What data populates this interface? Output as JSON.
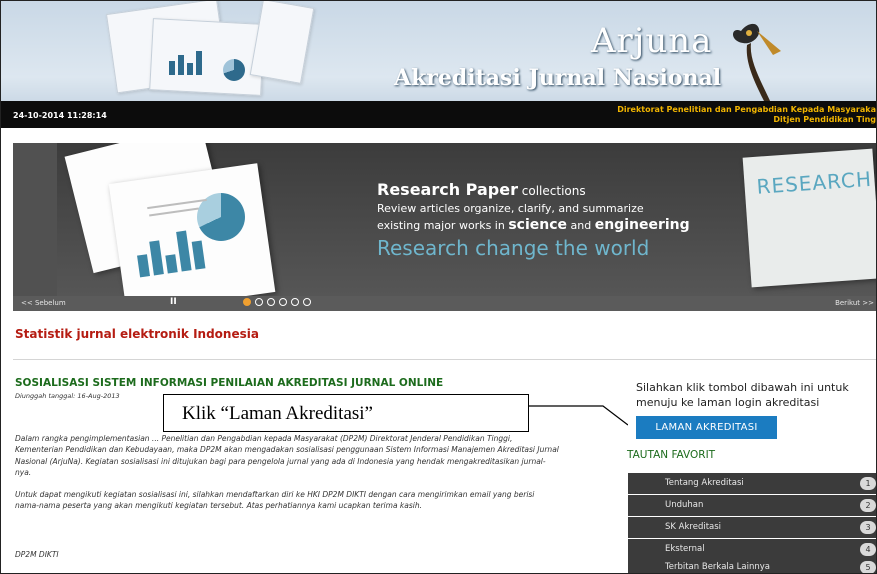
{
  "header": {
    "title_main": "Arjuna",
    "title_sub": "Akreditasi Jurnal Nasional",
    "datetime": "24-10-2014  11:28:14",
    "directorate_line1": "Direktorat Penelitian dan Pengabdian Kepada Masyaraka",
    "directorate_line2": "Ditjen Pendidikan Ting"
  },
  "slider": {
    "heading_bold": "Research Paper",
    "heading_light": " collections",
    "line1": "Review articles organize, clarify, and summarize",
    "line2_prefix": "existing major works in ",
    "line2_science": "science",
    "line2_mid": " and ",
    "line2_engineering": "engineering",
    "tagline": "Research change the world",
    "image_word": "RESEARCH",
    "prev_label": "<< Sebelum",
    "pause_label": "II",
    "next_label": "Berikut >>",
    "slide_count": 6,
    "active_slide": 0
  },
  "statistik_title": "Statistik jurnal elektronik Indonesia",
  "article": {
    "title": "SOSIALISASI SISTEM INFORMASI PENILAIAN AKREDITASI JURNAL ONLINE",
    "date": "Diunggah tanggal: 16-Aug-2013",
    "para1": "Dalam rangka pengimplementasian ... Penelitian dan Pengabdian kepada Masyarakat (DP2M) Direktorat Jenderal Pendidikan Tinggi, Kementerian Pendidikan dan Kebudayaan, maka DP2M akan mengadakan sosialisasi penggunaan Sistem Informasi Manajemen Akreditasi Jurnal Nasional (ArjuNa). Kegiatan sosialisasi ini ditujukan bagi para pengelola jurnal yang ada di Indonesia yang hendak mengakreditasikan jurnal-nya.",
    "para2": "Untuk dapat mengikuti kegiatan sosialisasi ini, silahkan mendaftarkan diri ke HKI DP2M DIKTI dengan cara mengirimkan email yang berisi nama-nama peserta yang akan mengikuti kegiatan tersebut. Atas perhatiannya kami ucapkan terima kasih.",
    "signature": "DP2M DIKTI"
  },
  "callout": "Klik “Laman Akreditasi”",
  "sidebar": {
    "login_text": "Silahkan klik tombol dibawah ini untuk menuju ke laman login akreditasi",
    "login_button": "LAMAN AKREDITASI",
    "favorites_title": "TAUTAN FAVORIT",
    "favorites": [
      {
        "label": "Tentang Akreditasi",
        "count": "1"
      },
      {
        "label": "Unduhan",
        "count": "2"
      },
      {
        "label": "SK Akreditasi",
        "count": "3"
      },
      {
        "label": "Eksternal",
        "count": "4"
      },
      {
        "label": "Terbitan Berkala Lainnya",
        "count": "5"
      }
    ]
  },
  "colors": {
    "accent_red": "#b51c12",
    "article_green": "#1c6b1c",
    "button_blue": "#1b7cc1",
    "gold": "#f0b400"
  }
}
